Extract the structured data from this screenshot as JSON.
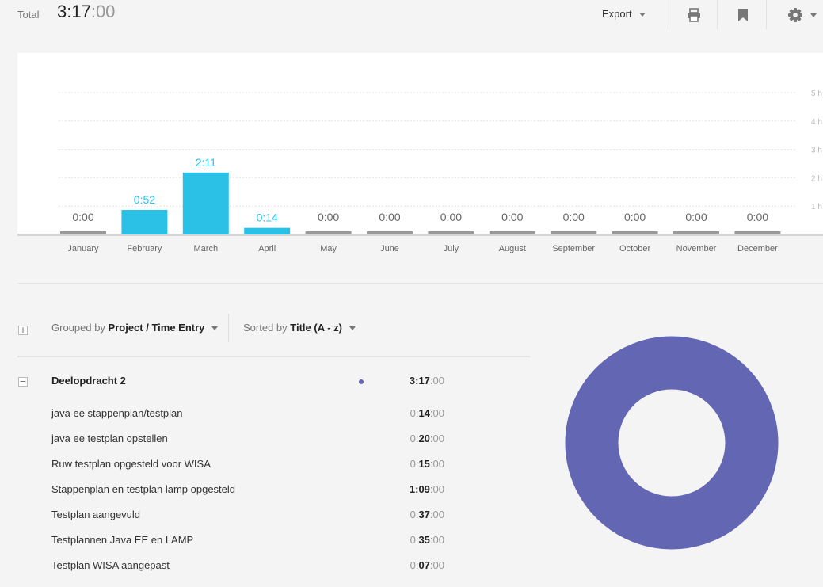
{
  "header": {
    "total_label": "Total",
    "total_hm": "3:17",
    "total_sec": ":00",
    "export_label": "Export",
    "icons": [
      "print-icon",
      "bookmark-icon",
      "gear-icon"
    ]
  },
  "chart_data": {
    "type": "bar",
    "categories": [
      "January",
      "February",
      "March",
      "April",
      "May",
      "June",
      "July",
      "August",
      "September",
      "October",
      "November",
      "December"
    ],
    "values": [
      0,
      52,
      131,
      14,
      0,
      0,
      0,
      0,
      0,
      0,
      0,
      0
    ],
    "value_unit": "minutes",
    "data_labels": [
      "0:00",
      "0:52",
      "2:11",
      "0:14",
      "0:00",
      "0:00",
      "0:00",
      "0:00",
      "0:00",
      "0:00",
      "0:00",
      "0:00"
    ],
    "y_ticks": [
      "1 h",
      "2 h",
      "3 h",
      "4 h",
      "5 h"
    ],
    "ylim": [
      0,
      300
    ],
    "bar_color": "#2bc1e6",
    "empty_bar_color": "#999999",
    "grid": true
  },
  "grouping": {
    "expand_symbol": "+",
    "grouped_prefix": "Grouped by ",
    "grouped_value": "Project / Time Entry",
    "sorted_prefix": "Sorted by ",
    "sorted_value": "Title (A - z)"
  },
  "project": {
    "collapse_symbol": "−",
    "name": "Deelopdracht 2",
    "color": "#6366b3",
    "duration_hm": "3:17",
    "duration_sec": ":00"
  },
  "entries": [
    {
      "title": "java ee stappenplan/testplan",
      "h": "0:",
      "m": "14",
      "s": ":00"
    },
    {
      "title": "java ee testplan opstellen",
      "h": "0:",
      "m": "20",
      "s": ":00"
    },
    {
      "title": "Ruw testplan opgesteld voor WISA",
      "h": "0:",
      "m": "15",
      "s": ":00"
    },
    {
      "title": "Stappenplan en testplan lamp opgesteld",
      "h": "1:",
      "m": "09",
      "s": ":00"
    },
    {
      "title": "Testplan aangevuld",
      "h": "0:",
      "m": "37",
      "s": ":00"
    },
    {
      "title": "Testplannen Java EE en LAMP",
      "h": "0:",
      "m": "35",
      "s": ":00"
    },
    {
      "title": "Testplan WISA aangepast",
      "h": "0:",
      "m": "07",
      "s": ":00"
    }
  ],
  "donut": {
    "slices": [
      {
        "name": "Deelopdracht 2",
        "value": 197,
        "color": "#6366b3"
      }
    ]
  }
}
